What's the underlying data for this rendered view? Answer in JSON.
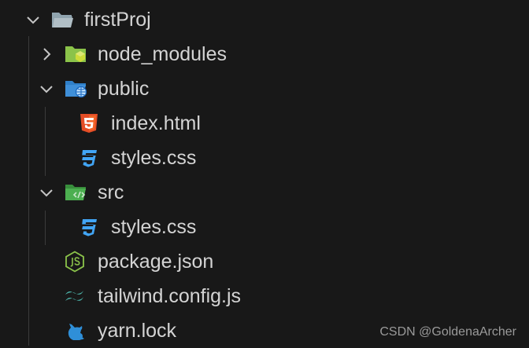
{
  "explorer": {
    "root": {
      "label": "firstProj",
      "expanded": true,
      "icon": "folder-open-icon"
    },
    "items": [
      {
        "label": "node_modules",
        "type": "folder",
        "expanded": false,
        "icon": "node-modules-folder-icon",
        "icon_color": "#8bc34a"
      },
      {
        "label": "public",
        "type": "folder",
        "expanded": true,
        "icon": "public-folder-icon",
        "icon_color": "#3f8fd8"
      },
      {
        "label": "index.html",
        "type": "file",
        "icon": "html5-icon",
        "icon_color": "#e44d26"
      },
      {
        "label": "styles.css",
        "type": "file",
        "icon": "css3-icon",
        "icon_color": "#42a5f5"
      },
      {
        "label": "src",
        "type": "folder",
        "expanded": true,
        "icon": "src-folder-icon",
        "icon_color": "#4caf50"
      },
      {
        "label": "styles.css",
        "type": "file",
        "icon": "css3-icon",
        "icon_color": "#42a5f5"
      },
      {
        "label": "package.json",
        "type": "file",
        "icon": "nodejs-icon",
        "icon_color": "#8bc34a"
      },
      {
        "label": "tailwind.config.js",
        "type": "file",
        "icon": "tailwind-icon",
        "icon_color": "#4db6ac"
      },
      {
        "label": "yarn.lock",
        "type": "file",
        "icon": "yarn-cat-icon",
        "icon_color": "#2f8fd8"
      }
    ]
  },
  "watermark": "CSDN @GoldenaArcher"
}
